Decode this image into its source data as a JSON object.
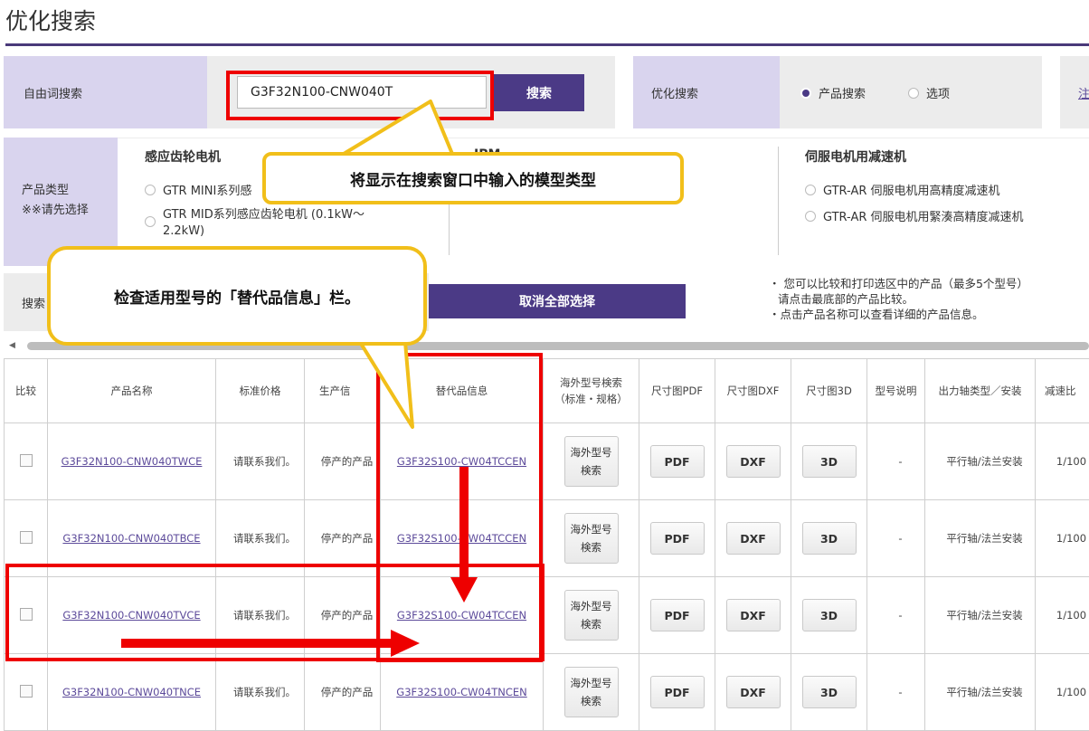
{
  "page": {
    "title": "优化搜索"
  },
  "free_search": {
    "label": "自由词搜索",
    "query": "G3F32N100-CNW040T",
    "button": "搜索"
  },
  "optimize": {
    "label": "优化搜索",
    "options": [
      {
        "label": "产品搜索",
        "checked": true
      },
      {
        "label": "选项",
        "checked": false
      }
    ],
    "clipped_link": "注"
  },
  "product_type": {
    "label": "产品类型",
    "hint": "※※请先选择",
    "groups": [
      {
        "title": "感应齿轮电机",
        "items": [
          "GTR MINI系列感",
          "GTR MID系列感应齿轮电机 (0.1kW～",
          "2.2kW)"
        ]
      },
      {
        "title": "IPM",
        "items": []
      },
      {
        "title": "伺服电机用减速机",
        "items": [
          "GTR-AR 伺服电机用高精度减速机",
          "GTR-AR 伺服电机用緊湊高精度减速机"
        ]
      }
    ]
  },
  "search_row": {
    "label_clipped": "搜索",
    "clear_button": "取消全部选择",
    "notes": [
      "・ 您可以比较和打印选区中的产品（最多5个型号）",
      "请点击最底部的产品比较。",
      "・点击产品名称可以查看详细的产品信息。"
    ]
  },
  "table": {
    "headers": [
      "比较",
      "产品名称",
      "标准价格",
      "生产信",
      "替代品信息",
      "海外型号検索",
      "（标准・规格）",
      "尺寸图PDF",
      "尺寸图DXF",
      "尺寸图3D",
      "型号说明",
      "出力轴类型／安装",
      "减速比"
    ],
    "overseas_button": [
      "海外型号",
      "検索"
    ],
    "pdf_label": "PDF",
    "dxf_label": "DXF",
    "cad_label": "3D",
    "rows": [
      {
        "name": "G3F32N100-CNW040TWCE",
        "price": "请联系我们。",
        "status": "停产的产品",
        "alt": "G3F32S100-CW04TCCEN",
        "desc": "-",
        "shaft": "平行轴/法兰安装",
        "ratio": "1/100"
      },
      {
        "name": "G3F32N100-CNW040TBCE",
        "price": "请联系我们。",
        "status": "停产的产品",
        "alt": "G3F32S100-CW04TCCEN",
        "desc": "-",
        "shaft": "平行轴/法兰安装",
        "ratio": "1/100"
      },
      {
        "name": "G3F32N100-CNW040TVCE",
        "price": "请联系我们。",
        "status": "停产的产品",
        "alt": "G3F32S100-CW04TCCEN",
        "desc": "-",
        "shaft": "平行轴/法兰安装",
        "ratio": "1/100"
      },
      {
        "name": "G3F32N100-CNW040TNCE",
        "price": "请联系我们。",
        "status": "停产的产品",
        "alt": "G3F32S100-CW04TNCEN",
        "desc": "-",
        "shaft": "平行轴/法兰安装",
        "ratio": "1/100"
      }
    ]
  },
  "annotations": {
    "callout_search": "将显示在搜索窗口中输入的模型类型",
    "callout_alt": "检查适用型号的「替代品信息」栏。",
    "red": "#e00000",
    "yellow": "#f1bf1a"
  },
  "colors": {
    "accent": "#4b3a86",
    "label_bg": "#d9d4ee",
    "panel_bg": "#ececec"
  }
}
